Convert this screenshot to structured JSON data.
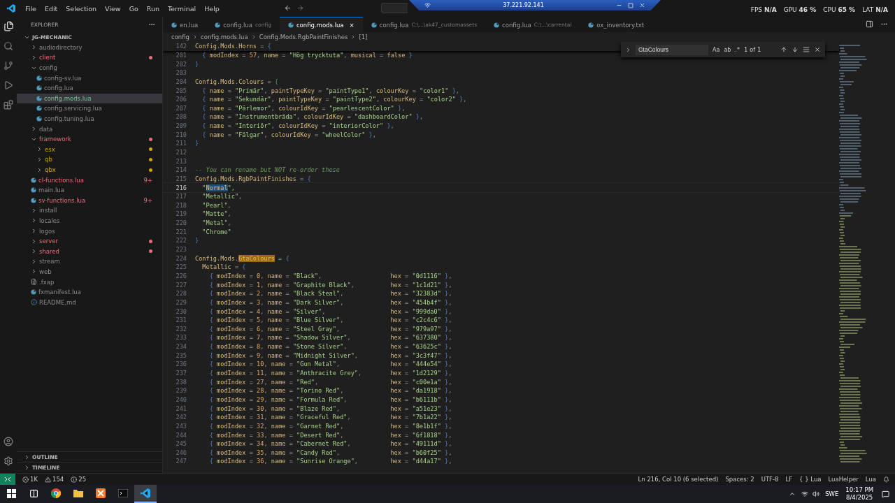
{
  "menu": [
    "File",
    "Edit",
    "Selection",
    "View",
    "Go",
    "Run",
    "Terminal",
    "Help"
  ],
  "remote_bar": {
    "address": "37.221.92.141"
  },
  "stats": [
    {
      "label": "FPS",
      "value": "N/A"
    },
    {
      "label": "GPU",
      "value": "46 %"
    },
    {
      "label": "CPU",
      "value": "65 %"
    },
    {
      "label": "LAT",
      "value": "N/A"
    }
  ],
  "sidebar": {
    "title": "EXPLORER",
    "root": "JG-MECHANIC",
    "items": [
      {
        "name": "audiodirectory",
        "kind": "folder",
        "expanded": false,
        "selected": false,
        "ignored": true,
        "errors": false,
        "warnings": false,
        "untracked": false
      },
      {
        "name": "client",
        "kind": "folder",
        "expanded": false,
        "selected": false,
        "ignored": false,
        "errors": true,
        "warnings": false,
        "untracked": false,
        "dot": true
      },
      {
        "name": "config",
        "kind": "folder",
        "expanded": true,
        "selected": false,
        "ignored": true,
        "errors": false,
        "warnings": false,
        "untracked": false,
        "children": [
          {
            "name": "config-sv.lua",
            "kind": "lua",
            "selected": false,
            "ignored": true,
            "errors": false,
            "warnings": false,
            "untracked": false
          },
          {
            "name": "config.lua",
            "kind": "lua",
            "selected": false,
            "ignored": true,
            "errors": false,
            "warnings": false,
            "untracked": false
          },
          {
            "name": "config.mods.lua",
            "kind": "lua",
            "selected": true,
            "ignored": false,
            "errors": false,
            "warnings": false,
            "untracked": true
          },
          {
            "name": "config.servicing.lua",
            "kind": "lua",
            "selected": false,
            "ignored": true,
            "errors": false,
            "warnings": false,
            "untracked": false
          },
          {
            "name": "config.tuning.lua",
            "kind": "lua",
            "selected": false,
            "ignored": true,
            "errors": false,
            "warnings": false,
            "untracked": false
          }
        ]
      },
      {
        "name": "data",
        "kind": "folder",
        "expanded": false,
        "selected": false,
        "ignored": true,
        "errors": false,
        "warnings": false,
        "untracked": false
      },
      {
        "name": "framework",
        "kind": "folder",
        "expanded": true,
        "selected": false,
        "ignored": false,
        "errors": true,
        "warnings": false,
        "untracked": false,
        "dot": true,
        "children": [
          {
            "name": "esx",
            "kind": "folder",
            "expanded": false,
            "selected": false,
            "ignored": false,
            "errors": false,
            "warnings": true,
            "untracked": false,
            "dot": true
          },
          {
            "name": "qb",
            "kind": "folder",
            "expanded": false,
            "selected": false,
            "ignored": false,
            "errors": false,
            "warnings": true,
            "untracked": false,
            "dot": true
          },
          {
            "name": "qbx",
            "kind": "folder",
            "expanded": false,
            "selected": false,
            "ignored": false,
            "errors": false,
            "warnings": true,
            "untracked": false,
            "dot": true
          }
        ]
      },
      {
        "name": "cl-functions.lua",
        "kind": "lua",
        "selected": false,
        "ignored": false,
        "errors": true,
        "warnings": false,
        "untracked": false,
        "badge": "9+"
      },
      {
        "name": "main.lua",
        "kind": "lua",
        "selected": false,
        "ignored": true,
        "errors": false,
        "warnings": false,
        "untracked": false
      },
      {
        "name": "sv-functions.lua",
        "kind": "lua",
        "selected": false,
        "ignored": false,
        "errors": true,
        "warnings": false,
        "untracked": false,
        "badge": "9+"
      },
      {
        "name": "install",
        "kind": "folder",
        "expanded": false,
        "selected": false,
        "ignored": true,
        "errors": false,
        "warnings": false,
        "untracked": false
      },
      {
        "name": "locales",
        "kind": "folder",
        "expanded": false,
        "selected": false,
        "ignored": true,
        "errors": false,
        "warnings": false,
        "untracked": false
      },
      {
        "name": "logos",
        "kind": "folder",
        "expanded": false,
        "selected": false,
        "ignored": true,
        "errors": false,
        "warnings": false,
        "untracked": false
      },
      {
        "name": "server",
        "kind": "folder",
        "expanded": false,
        "selected": false,
        "ignored": false,
        "errors": true,
        "warnings": false,
        "untracked": false,
        "dot": true
      },
      {
        "name": "shared",
        "kind": "folder",
        "expanded": false,
        "selected": false,
        "ignored": false,
        "errors": true,
        "warnings": false,
        "untracked": false,
        "dot": true
      },
      {
        "name": "stream",
        "kind": "folder",
        "expanded": false,
        "selected": false,
        "ignored": true,
        "errors": false,
        "warnings": false,
        "untracked": false
      },
      {
        "name": "web",
        "kind": "folder",
        "expanded": false,
        "selected": false,
        "ignored": true,
        "errors": false,
        "warnings": false,
        "untracked": false
      },
      {
        "name": ".fxap",
        "kind": "file",
        "selected": false,
        "ignored": true,
        "errors": false,
        "warnings": false,
        "untracked": false
      },
      {
        "name": "fxmanifest.lua",
        "kind": "lua",
        "selected": false,
        "ignored": true,
        "errors": false,
        "warnings": false,
        "untracked": false
      },
      {
        "name": "README.md",
        "kind": "info",
        "selected": false,
        "ignored": true,
        "errors": false,
        "warnings": false,
        "untracked": false
      }
    ],
    "sections": [
      "OUTLINE",
      "TIMELINE"
    ]
  },
  "tabs": [
    {
      "label": "en.lua",
      "selected": false
    },
    {
      "label": "config.lua",
      "description": "config",
      "selected": false
    },
    {
      "label": "config.mods.lua",
      "selected": true,
      "close": "×"
    },
    {
      "label": "config.lua",
      "description": "C:\\...\\ak47_customassets",
      "selected": false
    },
    {
      "label": "config.lua",
      "description": "C:\\...\\carrental",
      "selected": false
    },
    {
      "label": "ox_inventory.txt",
      "selected": false
    }
  ],
  "breadcrumbs": [
    "config",
    "config.mods.lua",
    "Config.Mods.RgbPaintFinishes",
    "[1]"
  ],
  "find": {
    "value": "GtaColours",
    "options": [
      "Aa",
      "ab",
      ".*"
    ],
    "count": "1 of 1"
  },
  "editor": {
    "sticky": {
      "number": "142",
      "text": "Config.Mods.Horns = {"
    },
    "lines": [
      {
        "number": "201",
        "text": "  { modIndex = 57, name = \"Hög trycktuta\", musical = false }"
      },
      {
        "number": "202",
        "text": "}"
      },
      {
        "number": "203"
      },
      {
        "number": "204",
        "text": "Config.Mods.Colours = {"
      },
      {
        "number": "205",
        "text": "  { name = \"Primär\", paintTypeKey = \"paintType1\", colourKey = \"color1\" },"
      },
      {
        "number": "206",
        "text": "  { name = \"Sekundär\", paintTypeKey = \"paintType2\", colourKey = \"color2\" },"
      },
      {
        "number": "207",
        "text": "  { name = \"Pärlemor\", colourIdKey = \"pearlescentColor\" },"
      },
      {
        "number": "208",
        "text": "  { name = \"Instrumentbräda\", colourIdKey = \"dashboardColor\" },"
      },
      {
        "number": "209",
        "text": "  { name = \"Interiör\", colourIdKey = \"interiorColor\" },"
      },
      {
        "number": "210",
        "text": "  { name = \"Fälgar\", colourIdKey = \"wheelColor\" },"
      },
      {
        "number": "211",
        "text": "}"
      },
      {
        "number": "212"
      },
      {
        "number": "213"
      },
      {
        "number": "214",
        "text": "-- You can rename but NOT re-order these"
      },
      {
        "number": "215",
        "text": "Config.Mods.RgbPaintFinishes = {"
      },
      {
        "number": "216",
        "current": true,
        "parts": [
          {
            "text": "  \""
          },
          {
            "text": "Normal",
            "selected": true
          },
          {
            "text": "\","
          }
        ]
      },
      {
        "number": "217",
        "text": "  \"Metallic\","
      },
      {
        "number": "218",
        "text": "  \"Pearl\","
      },
      {
        "number": "219",
        "text": "  \"Matte\","
      },
      {
        "number": "220",
        "text": "  \"Metal\","
      },
      {
        "number": "221",
        "text": "  \"Chrome\""
      },
      {
        "number": "222",
        "text": "}"
      },
      {
        "number": "223"
      },
      {
        "number": "224",
        "parts": [
          {
            "text": "Config.Mods."
          },
          {
            "text": "GtaColours",
            "matched": true
          },
          {
            "text": " = {"
          }
        ]
      },
      {
        "number": "225",
        "text": "  Metallic = {"
      },
      {
        "number": "226",
        "text": "    { modIndex = 0, name = \"Black\",",
        "tail": "hex = \"0d1116\" },"
      },
      {
        "number": "227",
        "text": "    { modIndex = 1, name = \"Graphite Black\",",
        "tail": "hex = \"1c1d21\" },"
      },
      {
        "number": "228",
        "text": "    { modIndex = 2, name = \"Black Steal\",",
        "tail": "hex = \"32383d\" },"
      },
      {
        "number": "229",
        "text": "    { modIndex = 3, name = \"Dark Silver\",",
        "tail": "hex = \"454b4f\" },"
      },
      {
        "number": "230",
        "text": "    { modIndex = 4, name = \"Silver\",",
        "tail": "hex = \"999da0\" },"
      },
      {
        "number": "231",
        "text": "    { modIndex = 5, name = \"Blue Silver\",",
        "tail": "hex = \"c2c4c6\" },"
      },
      {
        "number": "232",
        "text": "    { modIndex = 6, name = \"Steel Gray\",",
        "tail": "hex = \"979a97\" },"
      },
      {
        "number": "233",
        "text": "    { modIndex = 7, name = \"Shadow Silver\",",
        "tail": "hex = \"637380\" },"
      },
      {
        "number": "234",
        "text": "    { modIndex = 8, name = \"Stone Silver\",",
        "tail": "hex = \"63625c\" },"
      },
      {
        "number": "235",
        "text": "    { modIndex = 9, name = \"Midnight Silver\",",
        "tail": "hex = \"3c3f47\" },"
      },
      {
        "number": "236",
        "text": "    { modIndex = 10, name = \"Gun Metal\",",
        "tail": "hex = \"444e54\" },"
      },
      {
        "number": "237",
        "text": "    { modIndex = 11, name = \"Anthracite Grey\",",
        "tail": "hex = \"1d2129\" },"
      },
      {
        "number": "238",
        "text": "    { modIndex = 27, name = \"Red\",",
        "tail": "hex = \"c00e1a\" },"
      },
      {
        "number": "239",
        "text": "    { modIndex = 28, name = \"Torino Red\",",
        "tail": "hex = \"da1918\" },"
      },
      {
        "number": "240",
        "text": "    { modIndex = 29, name = \"Formula Red\",",
        "tail": "hex = \"b6111b\" },"
      },
      {
        "number": "241",
        "text": "    { modIndex = 30, name = \"Blaze Red\",",
        "tail": "hex = \"a51e23\" },"
      },
      {
        "number": "242",
        "text": "    { modIndex = 31, name = \"Graceful Red\",",
        "tail": "hex = \"7b1a22\" },"
      },
      {
        "number": "243",
        "text": "    { modIndex = 32, name = \"Garnet Red\",",
        "tail": "hex = \"8e1b1f\" },"
      },
      {
        "number": "244",
        "text": "    { modIndex = 33, name = \"Desert Red\",",
        "tail": "hex = \"6f1818\" },"
      },
      {
        "number": "245",
        "text": "    { modIndex = 34, name = \"Cabernet Red\",",
        "tail": "hex = \"49111d\" },"
      },
      {
        "number": "246",
        "text": "    { modIndex = 35, name = \"Candy Red\",",
        "tail": "hex = \"b60f25\" },"
      },
      {
        "number": "247",
        "text": "    { modIndex = 36, name = \"Sunrise Orange\",",
        "tail": "hex = \"d44a17\" },"
      }
    ]
  },
  "status_bar": {
    "problems": [
      {
        "kind": "error",
        "count": "1K"
      },
      {
        "kind": "warning",
        "count": "154"
      },
      {
        "kind": "info",
        "count": "25"
      }
    ],
    "right": [
      "Ln 216, Col 10 (6 selected)",
      "Spaces: 2",
      "UTF-8",
      "LF",
      "{ } Lua",
      "LuaHelper",
      "Lua"
    ]
  },
  "taskbar": {
    "apps": [
      {
        "kind": "start",
        "selected": false
      },
      {
        "kind": "taskview",
        "selected": false
      },
      {
        "kind": "chrome",
        "selected": false
      },
      {
        "kind": "files",
        "selected": false
      },
      {
        "kind": "xampp",
        "selected": false
      },
      {
        "kind": "terminal",
        "selected": false
      },
      {
        "kind": "vscode",
        "selected": true
      }
    ],
    "language": "SWE",
    "time": "10:17 PM",
    "date": "8/4/2025"
  }
}
